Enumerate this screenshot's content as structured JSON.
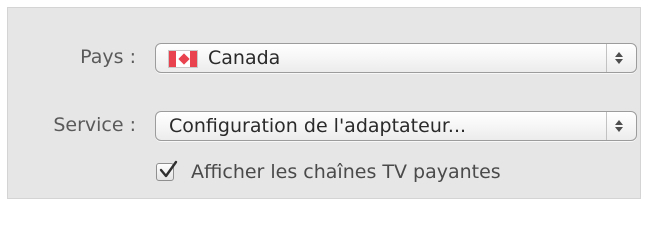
{
  "form": {
    "country_label": "Pays :",
    "country_value": "Canada",
    "service_label": "Service :",
    "service_value": "Configuration de l'adaptateur...",
    "show_paid_channels_label": "Afficher les chaînes TV payantes",
    "show_paid_channels_checked": true
  },
  "colors": {
    "panel_bg": "#e6e6e6",
    "flag_red": "#e8434e"
  }
}
